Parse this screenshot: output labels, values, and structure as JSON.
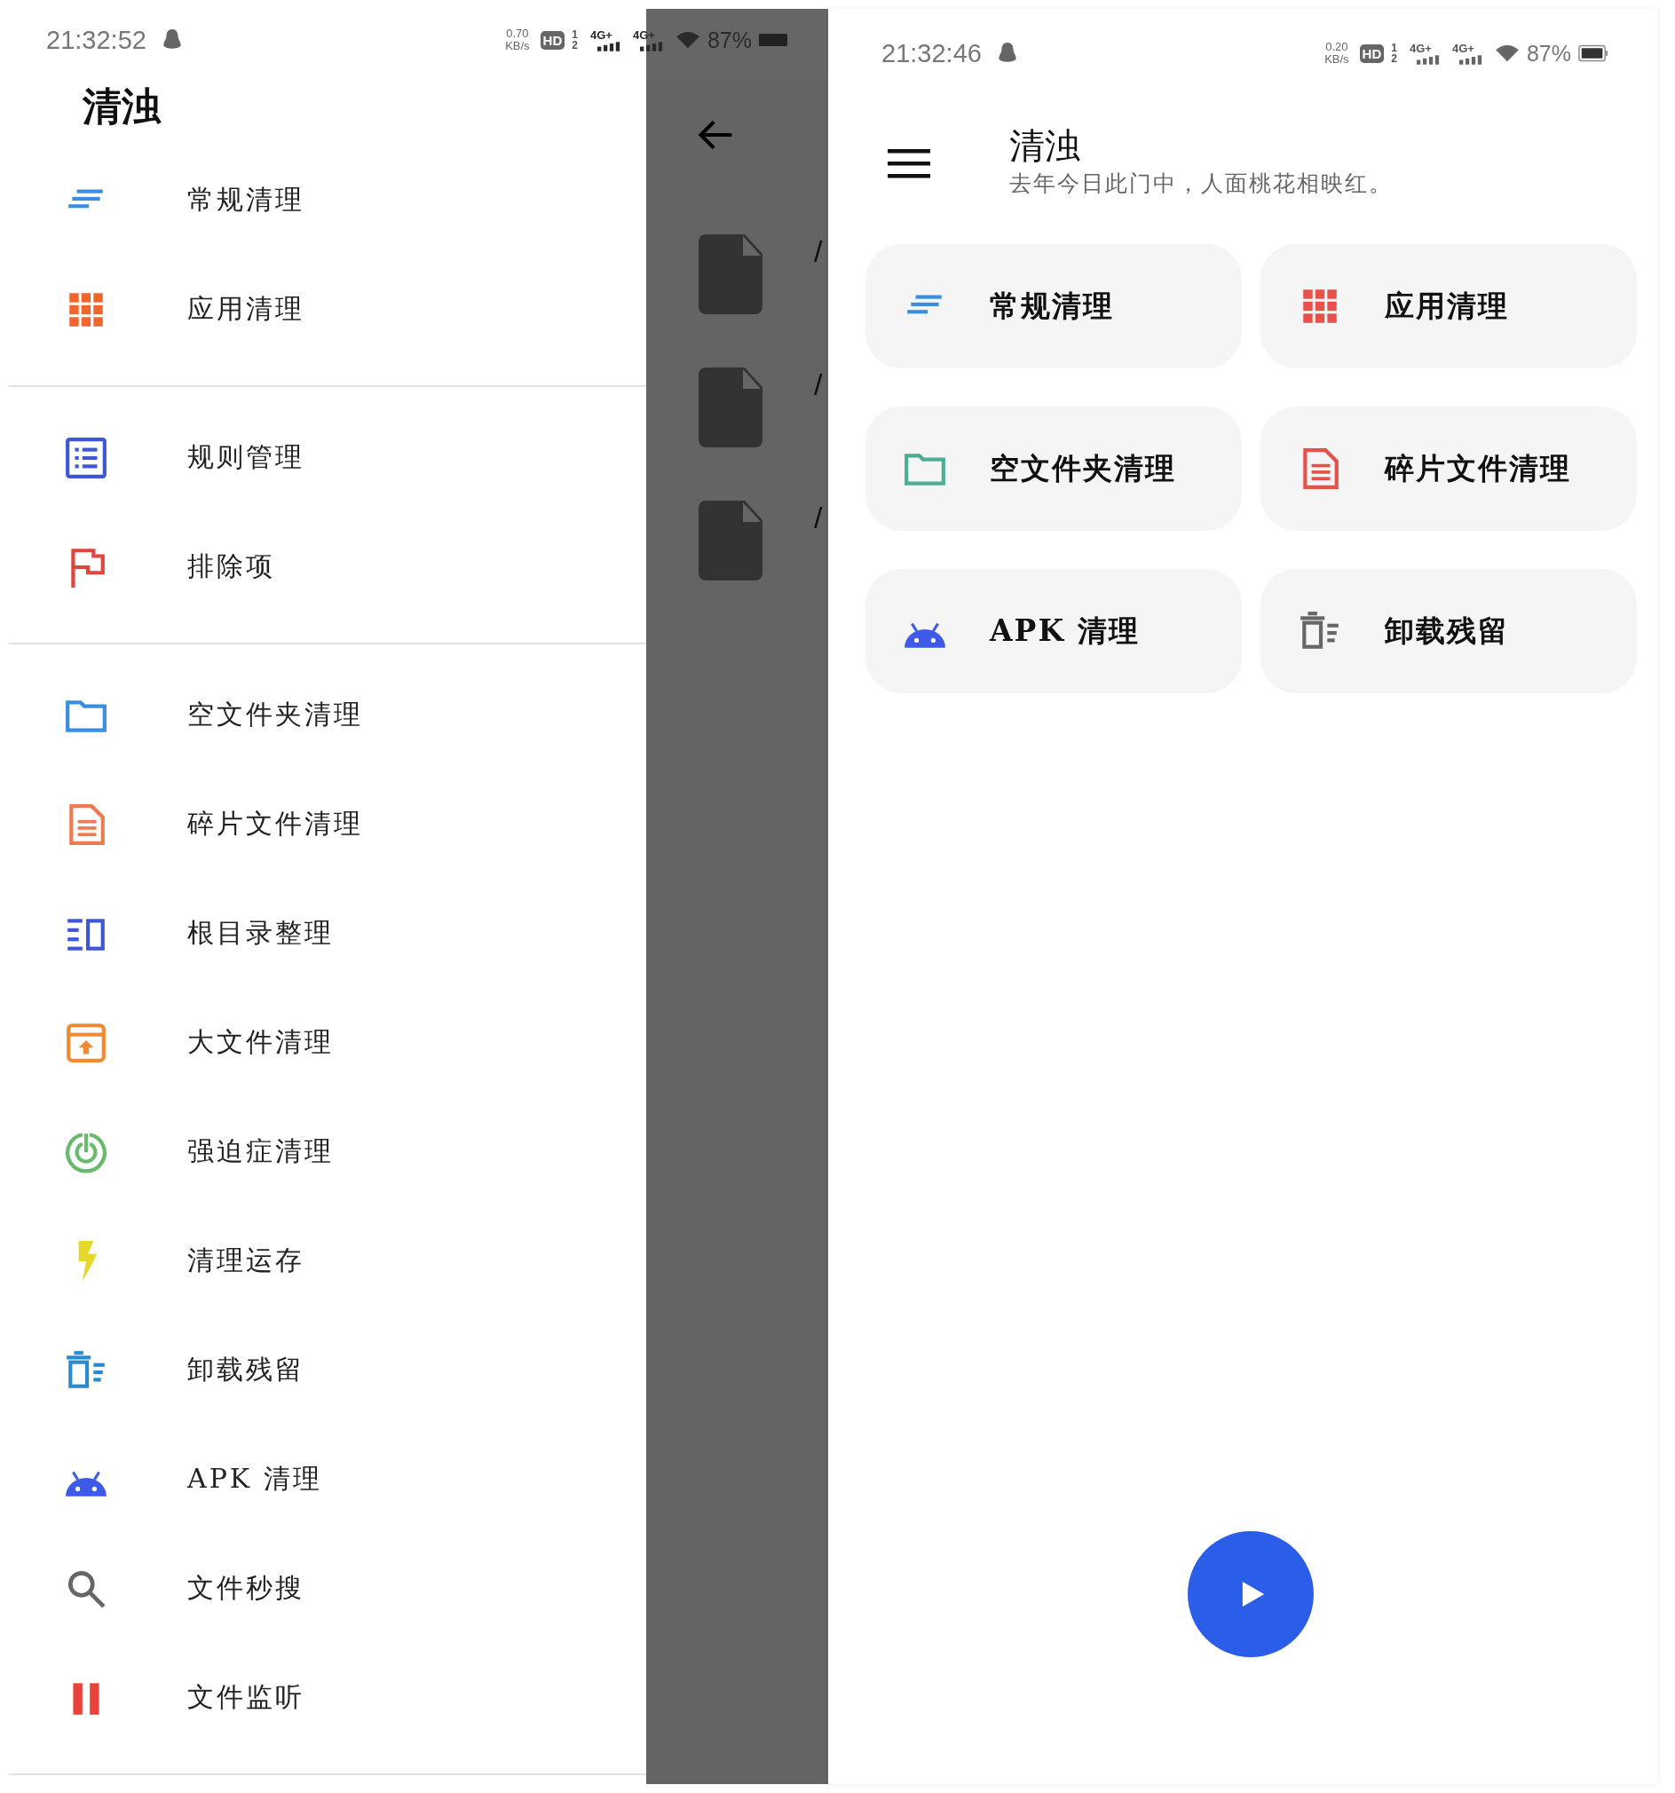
{
  "drawer_screen": {
    "status_bar": {
      "time": "21:32:52",
      "speed_value": "0.70",
      "speed_unit": "KB/s",
      "hd": "HD",
      "sim_slots": [
        "1",
        "2"
      ],
      "networks": [
        "4G+",
        "4G+"
      ],
      "battery": "87%"
    },
    "title": "清浊",
    "menu_groups": [
      [
        {
          "label": "常规清理",
          "kind": "lines",
          "color": "#3a8ee0"
        },
        {
          "label": "应用清理",
          "kind": "grid",
          "color": "#f0642e"
        }
      ],
      [
        {
          "label": "规则管理",
          "kind": "list",
          "color": "#3d57d6"
        },
        {
          "label": "排除项",
          "kind": "flag",
          "color": "#e0443c"
        }
      ],
      [
        {
          "label": "空文件夹清理",
          "kind": "folder",
          "color": "#3a8ee0"
        },
        {
          "label": "碎片文件清理",
          "kind": "document",
          "color": "#ee7a50"
        },
        {
          "label": "根目录整理",
          "kind": "columns",
          "color": "#3d57d6"
        },
        {
          "label": "大文件清理",
          "kind": "upload",
          "color": "#f08a30"
        },
        {
          "label": "强迫症清理",
          "kind": "target",
          "color": "#66bb6a"
        },
        {
          "label": "清理运存",
          "kind": "lightning",
          "color": "#e6d82a"
        },
        {
          "label": "卸载残留",
          "kind": "trash",
          "color": "#2a8ad0"
        },
        {
          "label": "APK 清理",
          "kind": "robot",
          "color": "#3d5ae8"
        },
        {
          "label": "文件秒搜",
          "kind": "search",
          "color": "#666666"
        },
        {
          "label": "文件监听",
          "kind": "pause",
          "color": "#e8423a"
        }
      ]
    ],
    "behind": {
      "file_rows": [
        "/",
        "/",
        "/"
      ]
    }
  },
  "home_screen": {
    "status_bar": {
      "time": "21:32:46",
      "speed_value": "0.20",
      "speed_unit": "KB/s",
      "hd": "HD",
      "sim_slots": [
        "1",
        "2"
      ],
      "networks": [
        "4G+",
        "4G+"
      ],
      "battery": "87%"
    },
    "title": "清浊",
    "subtitle": "去年今日此门中，人面桃花相映红。",
    "cards": [
      {
        "label": "常规清理",
        "kind": "lines",
        "color": "#3a8ee0"
      },
      {
        "label": "应用清理",
        "kind": "grid",
        "color": "#e8504a"
      },
      {
        "label": "空文件夹清理",
        "kind": "folder",
        "color": "#4caf93"
      },
      {
        "label": "碎片文件清理",
        "kind": "document",
        "color": "#e8504a"
      },
      {
        "label": "APK 清理",
        "kind": "robot",
        "color": "#3d5ae8"
      },
      {
        "label": "卸载残留",
        "kind": "trash",
        "color": "#666666"
      }
    ]
  }
}
